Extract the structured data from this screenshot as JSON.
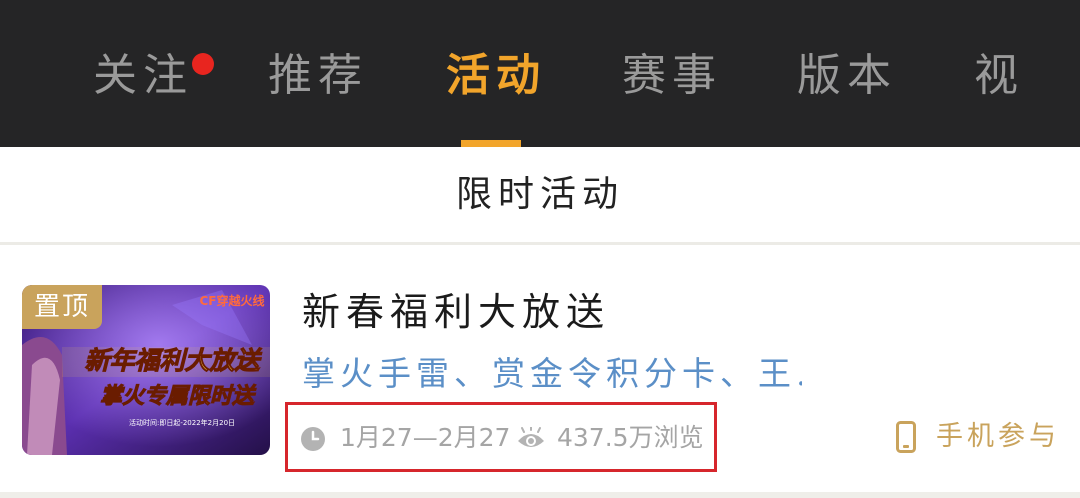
{
  "tabs": [
    {
      "label": "关注",
      "has_dot": true
    },
    {
      "label": "推荐"
    },
    {
      "label": "活动",
      "active": true
    },
    {
      "label": "赛事"
    },
    {
      "label": "版本"
    },
    {
      "label": "视"
    }
  ],
  "colors": {
    "header_bg": "#252526",
    "accent": "#f2a52b",
    "notify_dot": "#e8251f",
    "gold": "#c9a35c",
    "link_blue": "#5b8fc7",
    "highlight_border": "#d6262c"
  },
  "section": {
    "title": "限时活动"
  },
  "card": {
    "pin_badge": "置顶",
    "banner": {
      "logo_text": "CF穿越火线",
      "line1": "新年福利大放送",
      "line2": "掌火专属限时送",
      "fine_print": "活动时间:即日起-2022年2月20日"
    },
    "title": "新春福利大放送",
    "description": "掌火手雷、赏金令积分卡、王...",
    "date": "1月27—2月27",
    "views": "437.5万浏览",
    "join_label": "手机参与"
  }
}
